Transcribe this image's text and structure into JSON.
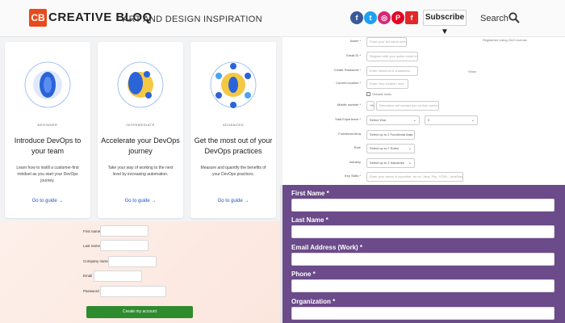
{
  "header": {
    "logo_mark": "CB",
    "logo_text": "CREATIVE BLOQ",
    "tagline": "ART AND DESIGN INSPIRATION",
    "social": [
      {
        "icon": "facebook-icon",
        "glyph": "f",
        "color": "#3b5998"
      },
      {
        "icon": "twitter-icon",
        "glyph": "t",
        "color": "#1da1f2"
      },
      {
        "icon": "instagram-icon",
        "glyph": "◎",
        "color": "#d62976"
      },
      {
        "icon": "pinterest-icon",
        "glyph": "P",
        "color": "#e60023"
      },
      {
        "icon": "flipboard-icon",
        "glyph": "f",
        "color": "#e12828"
      }
    ],
    "subscribe_label": "Subscribe ▼",
    "search_label": "Search"
  },
  "cards": [
    {
      "level": "BEGINNER",
      "title": "Introduce DevOps to your team",
      "desc": "Learn how to instill a customer-first mindset as you start your DevOps journey.",
      "link": "Go to guide →"
    },
    {
      "level": "INTERMEDIATE",
      "title": "Accelerate your DevOps journey",
      "desc": "Take your way of working to the next level by increasing automation.",
      "link": "Go to guide →"
    },
    {
      "level": "ADVANCED",
      "title": "Get the most out of your DevOps practices",
      "desc": "Measure and quantify the benefits of your DevOps practices.",
      "link": "Go to guide →"
    }
  ],
  "form_tr": {
    "fields": [
      {
        "label": "Name *",
        "placeholder": "Enter your full name here"
      },
      {
        "label": "Email ID *",
        "placeholder": "Register with your active email id"
      },
      {
        "label": "Create Password *",
        "placeholder": "Enter minimum 6 characters"
      },
      {
        "label": "Current location *",
        "placeholder": "Enter Your location here"
      },
      {
        "label": "Mobile number *",
        "placeholder": "Recruiters will contact you on this number"
      }
    ],
    "register_note": "Registered Using OLD License",
    "show_label": "Show",
    "checkbox_label": "Outside India",
    "country_code": "+91",
    "total_exp_label": "Total Experience *",
    "total_exp_year": "Select Year",
    "total_exp_month": "0",
    "functional_area_label": "Functional Area",
    "functional_area_value": "Select up to 2 Functional Area",
    "role_label": "Role",
    "role_value": "Select up to 2 Roles",
    "industry_label": "Industry",
    "industry_value": "Select up to 2 Industries",
    "keyskills_label": "Key Skills *",
    "keyskills_placeholder": "Enter your areas of expertise, for ex: Java, Php, HTML, JavaScript etc."
  },
  "form_bl": {
    "labels": [
      "First name",
      "Last name",
      "Company name",
      "Email",
      "Password"
    ],
    "button": "Create my account"
  },
  "form_br": {
    "labels": [
      "First Name *",
      "Last Name *",
      "Email Address (Work) *",
      "Phone *",
      "Organization *"
    ]
  }
}
